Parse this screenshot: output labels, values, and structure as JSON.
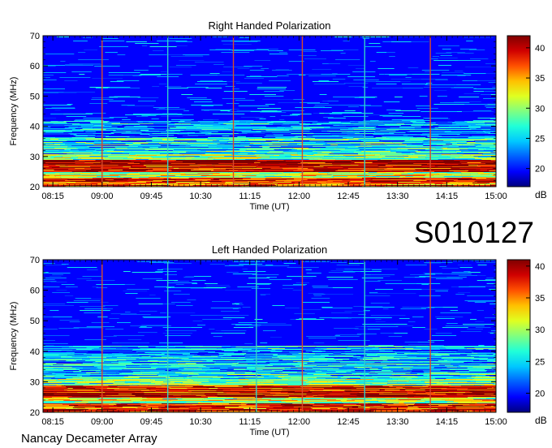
{
  "observation_id": "S010127",
  "instrument": "Nancay Decameter Array",
  "colors": {
    "colormap": [
      "#00007f",
      "#0000ff",
      "#0060ff",
      "#00c8ff",
      "#20ffd8",
      "#80ff80",
      "#e0ff20",
      "#ffc000",
      "#ff5000",
      "#d00000",
      "#7f0000"
    ],
    "vertical_marker_red": "#d84a2a",
    "vertical_marker_cyan": "#30d0c8"
  },
  "chart_data": [
    {
      "type": "heatmap",
      "title": "Right Handed Polarization",
      "xlabel": "Time (UT)",
      "ylabel": "Frequency (MHz)",
      "x_tick_labels": [
        "08:15",
        "09:00",
        "09:45",
        "10:30",
        "11:15",
        "12:00",
        "12:45",
        "13:30",
        "14:15",
        "15:00"
      ],
      "x_range_hours": [
        8.1,
        15.0
      ],
      "ylim": [
        20,
        70
      ],
      "y_ticks": [
        20,
        30,
        40,
        50,
        60,
        70
      ],
      "colorbar": {
        "label": "dB",
        "range": [
          17,
          42
        ],
        "ticks": [
          20,
          25,
          30,
          35,
          40
        ]
      },
      "intense_band_mhz": [
        20,
        30
      ],
      "vertical_markers_hours": {
        "red": [
          9.0,
          11.0,
          12.05,
          14.0
        ],
        "cyan": [
          10.0,
          13.0
        ]
      }
    },
    {
      "type": "heatmap",
      "title": "Left Handed Polarization",
      "xlabel": "Time (UT)",
      "ylabel": "Frequency (MHz)",
      "x_tick_labels": [
        "08:15",
        "09:00",
        "09:45",
        "10:30",
        "11:15",
        "12:00",
        "12:45",
        "13:30",
        "14:15",
        "15:00"
      ],
      "x_range_hours": [
        8.1,
        15.0
      ],
      "ylim": [
        20,
        70
      ],
      "y_ticks": [
        20,
        30,
        40,
        50,
        60,
        70
      ],
      "colorbar": {
        "label": "dB",
        "range": [
          17,
          41
        ],
        "ticks": [
          20,
          25,
          30,
          35,
          40
        ]
      },
      "intense_band_mhz": [
        20,
        30
      ],
      "vertical_markers_hours": {
        "red": [
          9.0,
          12.05,
          14.0
        ],
        "cyan": [
          10.0,
          11.35,
          13.0
        ]
      }
    }
  ]
}
